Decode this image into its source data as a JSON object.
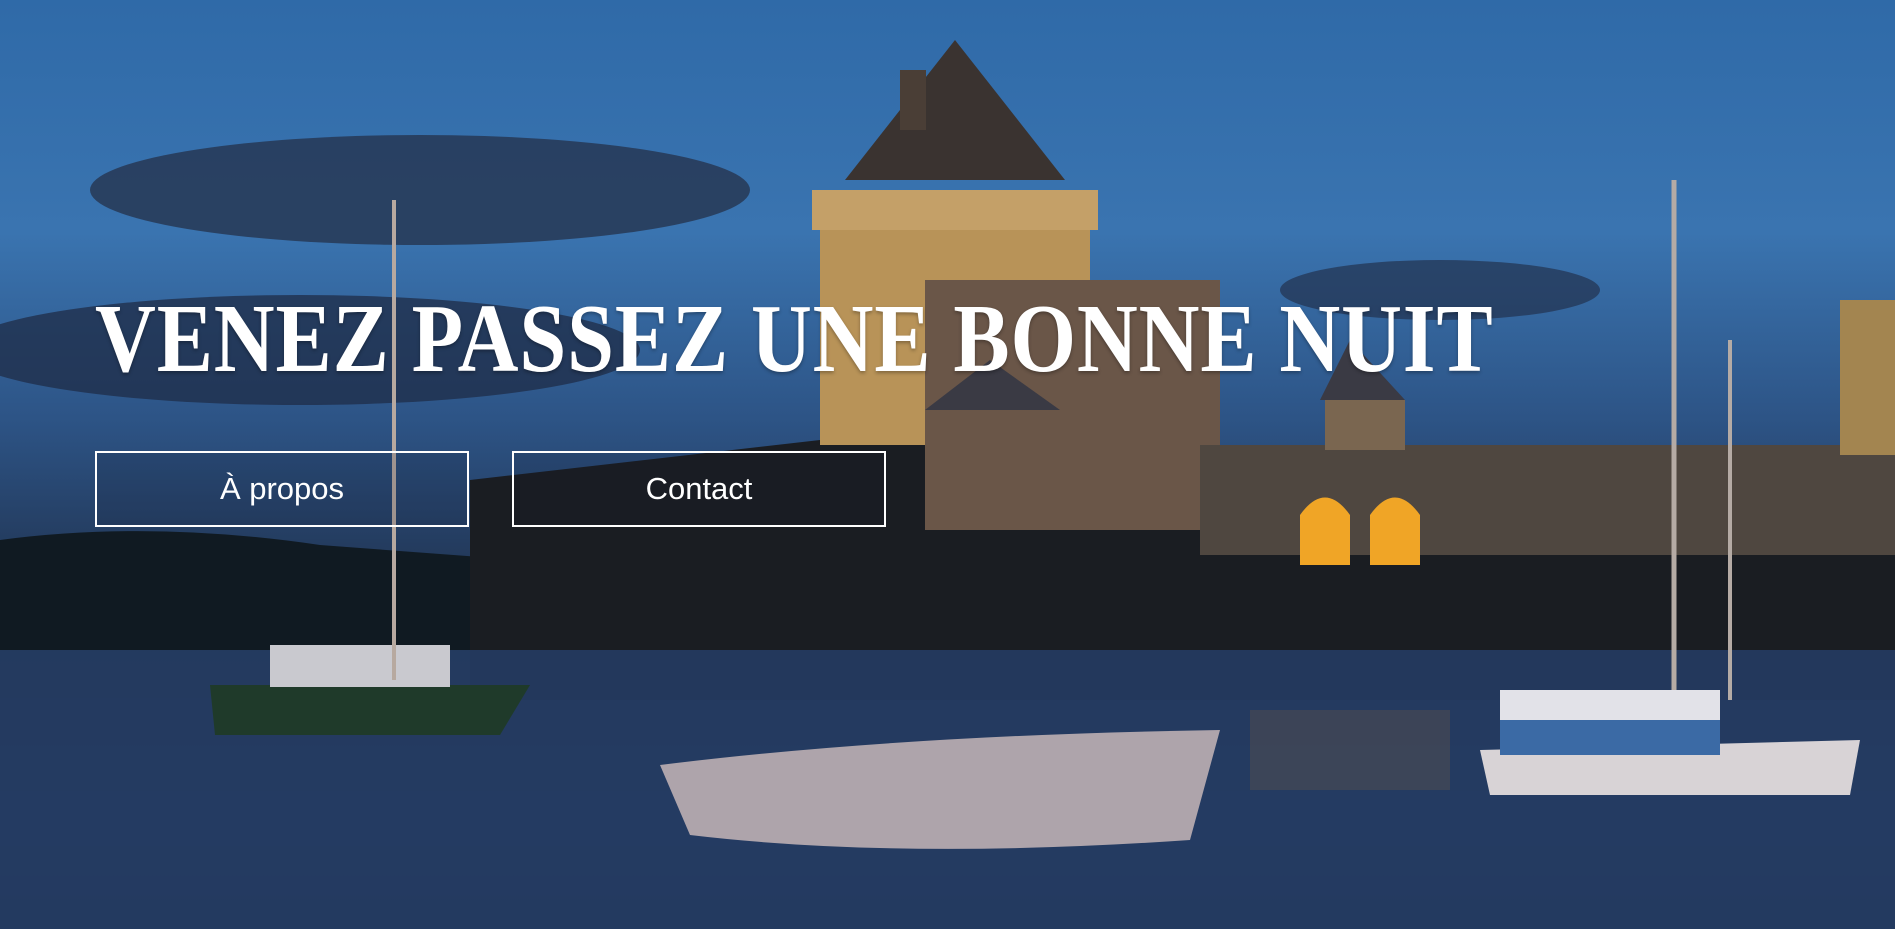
{
  "hero": {
    "title": "VENEZ PASSEZ UNE BONNE NUIT",
    "buttons": [
      {
        "label": "À propos"
      },
      {
        "label": "Contact"
      }
    ]
  }
}
